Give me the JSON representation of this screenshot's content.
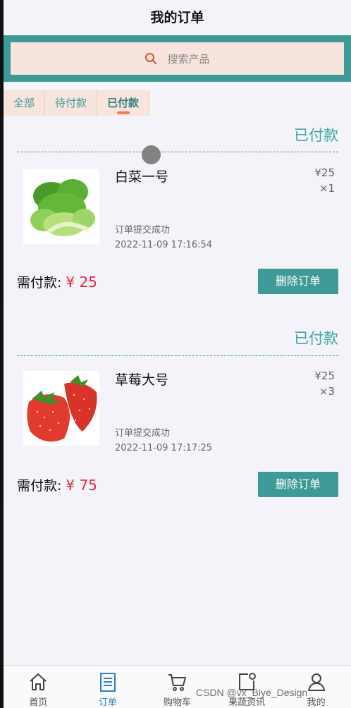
{
  "header": {
    "title": "我的订单"
  },
  "search": {
    "placeholder": "搜索产品"
  },
  "tabs": [
    {
      "label": "全部"
    },
    {
      "label": "待付款"
    },
    {
      "label": "已付款"
    }
  ],
  "orders": [
    {
      "status": "已付款",
      "product": "白菜一号",
      "image": "bok-choy",
      "price": "¥25",
      "qty": "×1",
      "state_text": "订单提交成功",
      "time": "2022-11-09 17:16:54",
      "need_label": "需付款:",
      "amount": "¥ 25",
      "delete_label": "删除订单"
    },
    {
      "status": "已付款",
      "product": "草莓大号",
      "image": "strawberry",
      "price": "¥25",
      "qty": "×3",
      "state_text": "订单提交成功",
      "time": "2022-11-09 17:17:25",
      "need_label": "需付款:",
      "amount": "¥ 75",
      "delete_label": "删除订单"
    }
  ],
  "nav": [
    {
      "label": "首页",
      "icon": "home-icon"
    },
    {
      "label": "订单",
      "icon": "orders-icon"
    },
    {
      "label": "购物车",
      "icon": "cart-icon"
    },
    {
      "label": "果蔬资讯",
      "icon": "news-icon"
    },
    {
      "label": "我的",
      "icon": "user-icon"
    }
  ],
  "watermark": "CSDN @vx_Biye_Design",
  "colors": {
    "accent": "#3d9a96",
    "search_bg": "#f7e4dd",
    "price_red": "#e8243c",
    "nav_active": "#2d7fd1"
  }
}
